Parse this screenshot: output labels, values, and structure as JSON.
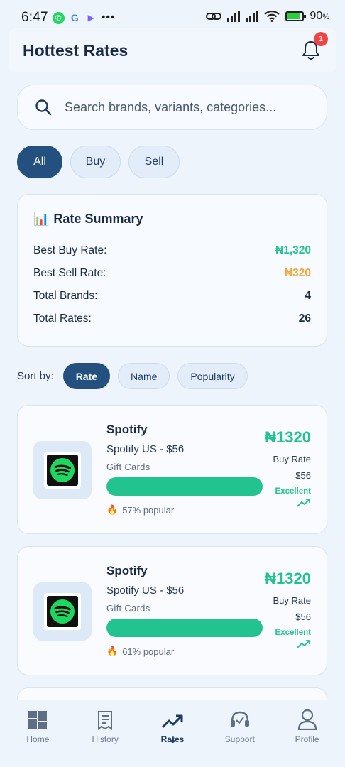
{
  "status_bar": {
    "time": "6:47",
    "battery": "90",
    "battery_unit": "%"
  },
  "header": {
    "title": "Hottest Rates",
    "notification_count": "1"
  },
  "search": {
    "placeholder": "Search brands, variants, categories..."
  },
  "filters": [
    {
      "label": "All",
      "active": true
    },
    {
      "label": "Buy",
      "active": false
    },
    {
      "label": "Sell",
      "active": false
    }
  ],
  "summary": {
    "icon": "📊",
    "title": "Rate Summary",
    "rows": [
      {
        "label": "Best Buy Rate:",
        "value": "₦1,320"
      },
      {
        "label": "Best Sell Rate:",
        "value": "₦320"
      },
      {
        "label": "Total Brands:",
        "value": "4"
      },
      {
        "label": "Total Rates:",
        "value": "26"
      }
    ]
  },
  "sort": {
    "label": "Sort by:",
    "options": [
      "Rate",
      "Name",
      "Popularity"
    ],
    "selected": "Rate"
  },
  "rates": [
    {
      "brand": "Spotify",
      "variant": "Spotify US - $56",
      "category": "Gift Cards",
      "popularity_pct": 57,
      "popular_text": "57% popular",
      "price": "₦1320",
      "rate_type": "Buy Rate",
      "denomination": "$56",
      "quality": "Excellent",
      "icon": "spotify-logo"
    },
    {
      "brand": "Spotify",
      "variant": "Spotify US - $56",
      "category": "Gift Cards",
      "popularity_pct": 61,
      "popular_text": "61% popular",
      "price": "₦1320",
      "rate_type": "Buy Rate",
      "denomination": "$56",
      "quality": "Excellent",
      "icon": "spotify-logo"
    }
  ],
  "bottom_nav": [
    {
      "label": "Home",
      "icon": "home-icon",
      "active": false
    },
    {
      "label": "History",
      "icon": "history-icon",
      "active": false
    },
    {
      "label": "Rates",
      "icon": "trending-up-icon",
      "active": true
    },
    {
      "label": "Support",
      "icon": "support-icon",
      "active": false
    },
    {
      "label": "Profile",
      "icon": "profile-icon",
      "active": false
    }
  ],
  "colors": {
    "primary": "#24507f",
    "accent_green": "#22c38e",
    "accent_orange": "#f4a73a",
    "badge_red": "#ef4444",
    "background": "#eef4fb"
  }
}
